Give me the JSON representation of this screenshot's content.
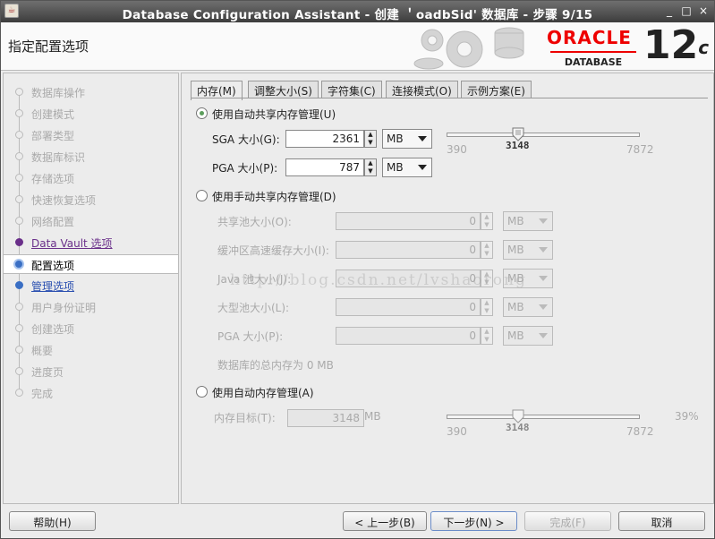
{
  "window": {
    "title": "Database Configuration Assistant - 创建 ＇oadbSid' 数据库 - 步骤 9/15",
    "controls": [
      "_",
      "□",
      "×"
    ]
  },
  "header": {
    "heading": "指定配置选项",
    "brand": "ORACLE",
    "brand_sub": "DATABASE",
    "version": "12",
    "version_suffix": "c"
  },
  "nav": {
    "items": [
      {
        "label": "数据库操作",
        "state": "pending"
      },
      {
        "label": "创建模式",
        "state": "pending"
      },
      {
        "label": "部署类型",
        "state": "pending"
      },
      {
        "label": "数据库标识",
        "state": "pending"
      },
      {
        "label": "存储选项",
        "state": "pending"
      },
      {
        "label": "快速恢复选项",
        "state": "pending"
      },
      {
        "label": "网络配置",
        "state": "pending"
      },
      {
        "label": "Data Vault 选项",
        "state": "done"
      },
      {
        "label": "配置选项",
        "state": "current"
      },
      {
        "label": "管理选项",
        "state": "next"
      },
      {
        "label": "用户身份证明",
        "state": "pending"
      },
      {
        "label": "创建选项",
        "state": "pending"
      },
      {
        "label": "概要",
        "state": "pending"
      },
      {
        "label": "进度页",
        "state": "pending"
      },
      {
        "label": "完成",
        "state": "pending"
      }
    ]
  },
  "tabs": [
    {
      "label": "内存(M)",
      "active": true
    },
    {
      "label": "调整大小(S)",
      "active": false
    },
    {
      "label": "字符集(C)",
      "active": false
    },
    {
      "label": "连接模式(O)",
      "active": false
    },
    {
      "label": "示例方案(E)",
      "active": false
    }
  ],
  "memory": {
    "auto_shared": {
      "label": "使用自动共享内存管理(U)",
      "selected": true,
      "sga_label": "SGA 大小(G):",
      "sga_value": "2361",
      "sga_unit": "MB",
      "pga_label": "PGA 大小(P):",
      "pga_value": "787",
      "pga_unit": "MB",
      "slider_min": "390",
      "slider_value": "3148",
      "slider_max": "7872"
    },
    "manual_shared": {
      "label": "使用手动共享内存管理(D)",
      "selected": false,
      "fields": [
        {
          "label": "共享池大小(O):",
          "value": "0",
          "unit": "MB"
        },
        {
          "label": "缓冲区高速缓存大小(I):",
          "value": "0",
          "unit": "MB"
        },
        {
          "label": "Java 池大小(J):",
          "value": "0",
          "unit": "MB"
        },
        {
          "label": "大型池大小(L):",
          "value": "0",
          "unit": "MB"
        },
        {
          "label": "PGA 大小(P):",
          "value": "0",
          "unit": "MB"
        }
      ],
      "total": "数据库的总内存为 0 MB"
    },
    "auto_memory": {
      "label": "使用自动内存管理(A)",
      "selected": false,
      "target_label": "内存目标(T):",
      "target_value": "3148",
      "target_unit": "MB",
      "slider_min": "390",
      "slider_value": "3148",
      "slider_max": "7872",
      "percent": "39%"
    }
  },
  "watermark": "http://blog.csdn.net/lvshaorong",
  "footer": {
    "help": "帮助(H)",
    "back": "< 上一步(B)",
    "next": "下一步(N) >",
    "finish": "完成(F)",
    "cancel": "取消"
  },
  "colors": {
    "oracle_red": "#e00000",
    "nav_done": "#6a2f8a",
    "nav_current": "#3a6fc4"
  }
}
